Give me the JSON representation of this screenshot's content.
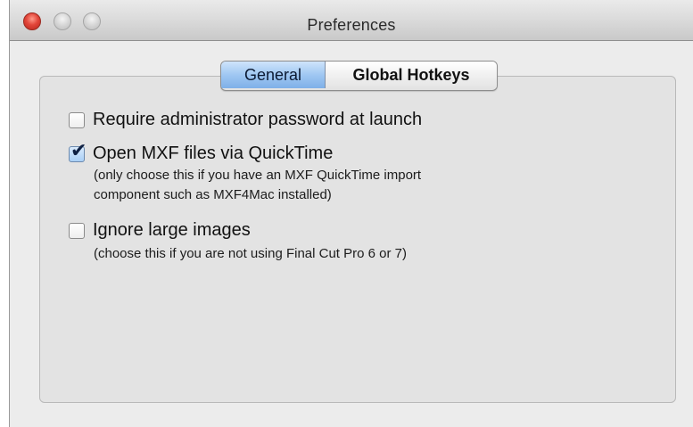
{
  "window": {
    "title": "Preferences"
  },
  "tabs": [
    {
      "label": "General",
      "selected": true
    },
    {
      "label": "Global Hotkeys",
      "selected": false
    }
  ],
  "options": [
    {
      "label": "Require administrator password at launch",
      "checked": false
    },
    {
      "label": "Open MXF files via QuickTime",
      "checked": true,
      "hint_lines": [
        "(only choose this if you have an MXF QuickTime import",
        "component such as MXF4Mac installed)"
      ]
    },
    {
      "label": "Ignore large images",
      "checked": false,
      "hint_lines": [
        "(choose this if you are not using Final Cut Pro 6 or 7)"
      ]
    }
  ],
  "icons": {
    "checkmark": "✔"
  },
  "colors": {
    "close_button": "#e2463a",
    "selected_tab": "#9fc7f2",
    "panel_background": "#e3e3e3"
  }
}
